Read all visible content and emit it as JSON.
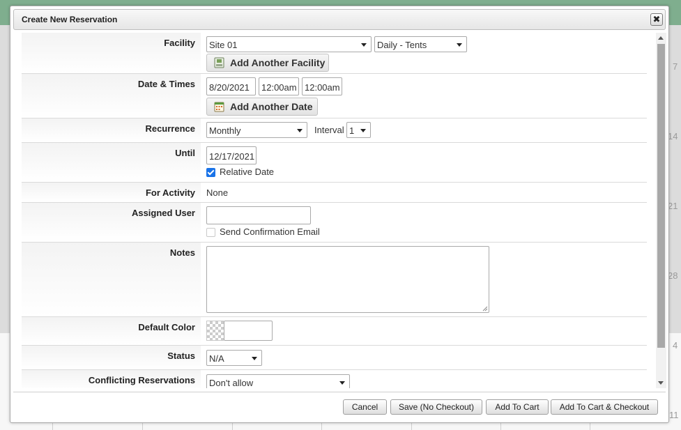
{
  "dialog": {
    "title": "Create New Reservation",
    "close_label": "✖"
  },
  "form": {
    "facility": {
      "label": "Facility",
      "site": "Site 01",
      "type": "Daily - Tents",
      "add_label": "Add Another Facility"
    },
    "date_times": {
      "label": "Date & Times",
      "date": "8/20/2021",
      "start_time": "12:00am",
      "end_time": "12:00am",
      "add_label": "Add Another Date"
    },
    "recurrence": {
      "label": "Recurrence",
      "value": "Monthly",
      "interval_label": "Interval",
      "interval_value": "1"
    },
    "until": {
      "label": "Until",
      "date": "12/17/2021",
      "relative_label": "Relative Date",
      "relative_checked": true
    },
    "activity": {
      "label": "For Activity",
      "value": "None"
    },
    "assigned_user": {
      "label": "Assigned User",
      "value": "",
      "send_email_label": "Send Confirmation Email",
      "send_email_checked": false
    },
    "notes": {
      "label": "Notes",
      "value": ""
    },
    "default_color": {
      "label": "Default Color",
      "value": ""
    },
    "status": {
      "label": "Status",
      "value": "N/A"
    },
    "conflicting": {
      "label": "Conflicting Reservations",
      "value": "Don't allow"
    }
  },
  "footer": {
    "cancel": "Cancel",
    "save": "Save (No Checkout)",
    "add_cart": "Add To Cart",
    "add_cart_checkout": "Add To Cart & Checkout"
  },
  "background": {
    "numbers": [
      "7",
      "14",
      "21",
      "28",
      "4",
      "11"
    ]
  },
  "colors": {
    "checkbox_accent": "#1a73e8",
    "header_bg": "#7fae8e"
  }
}
